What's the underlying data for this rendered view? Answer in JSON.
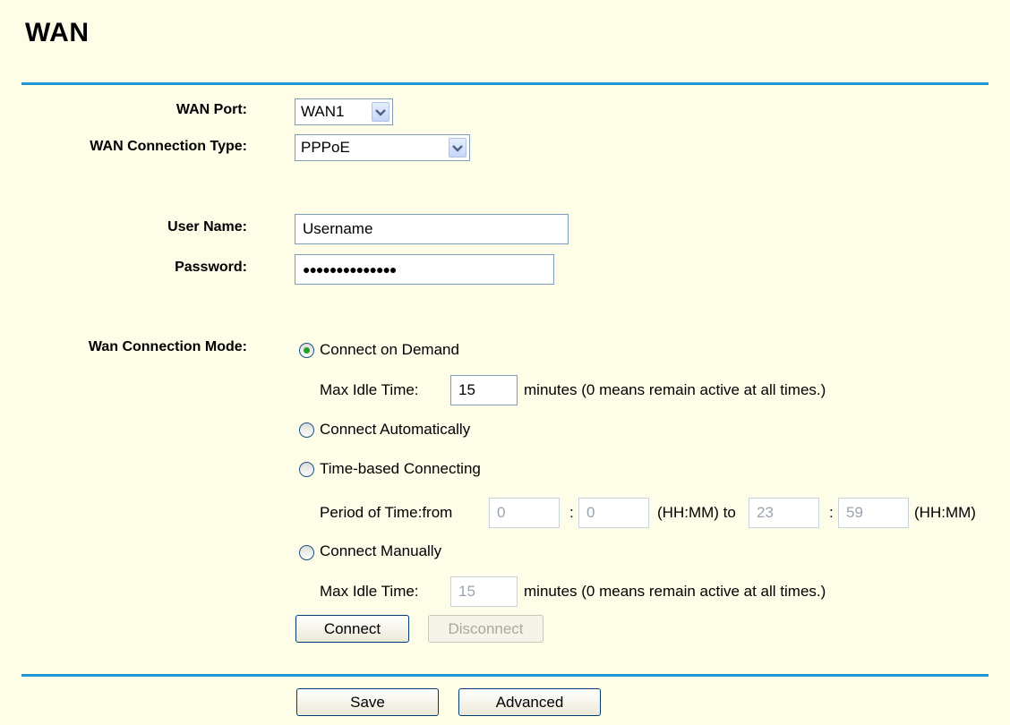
{
  "page": {
    "title": "WAN"
  },
  "form": {
    "wan_port": {
      "label": "WAN Port:",
      "value": "WAN1"
    },
    "connection_type": {
      "label": "WAN Connection Type:",
      "value": "PPPoE"
    },
    "username": {
      "label": "User Name:",
      "value": "Username"
    },
    "password": {
      "label": "Password:",
      "masked": "●●●●●●●●●●●●●●"
    },
    "mode": {
      "label": "Wan Connection Mode:",
      "on_demand": "Connect on Demand",
      "max_idle_label": "Max Idle Time:",
      "max_idle_value": "15",
      "minutes_note": "minutes (0 means remain active at all times.)",
      "automatic": "Connect Automatically",
      "time_based": "Time-based Connecting",
      "period_label": "Period of Time:from",
      "from_hh": "0",
      "colon": ":",
      "from_mm": "0",
      "hhmm_to": "(HH:MM) to",
      "to_hh": "23",
      "to_mm": "59",
      "hhmm": "(HH:MM)",
      "manual": "Connect Manually",
      "manual_idle_value": "15",
      "selected": "on_demand"
    },
    "connect_label": "Connect",
    "disconnect_label": "Disconnect"
  },
  "footer": {
    "save_label": "Save",
    "advanced_label": "Advanced"
  },
  "colors": {
    "rule": "#1f95d3",
    "background": "#fefde8",
    "radio_dot": "#21a121"
  },
  "icons": {
    "select_arrow": "chevron-down-icon"
  }
}
